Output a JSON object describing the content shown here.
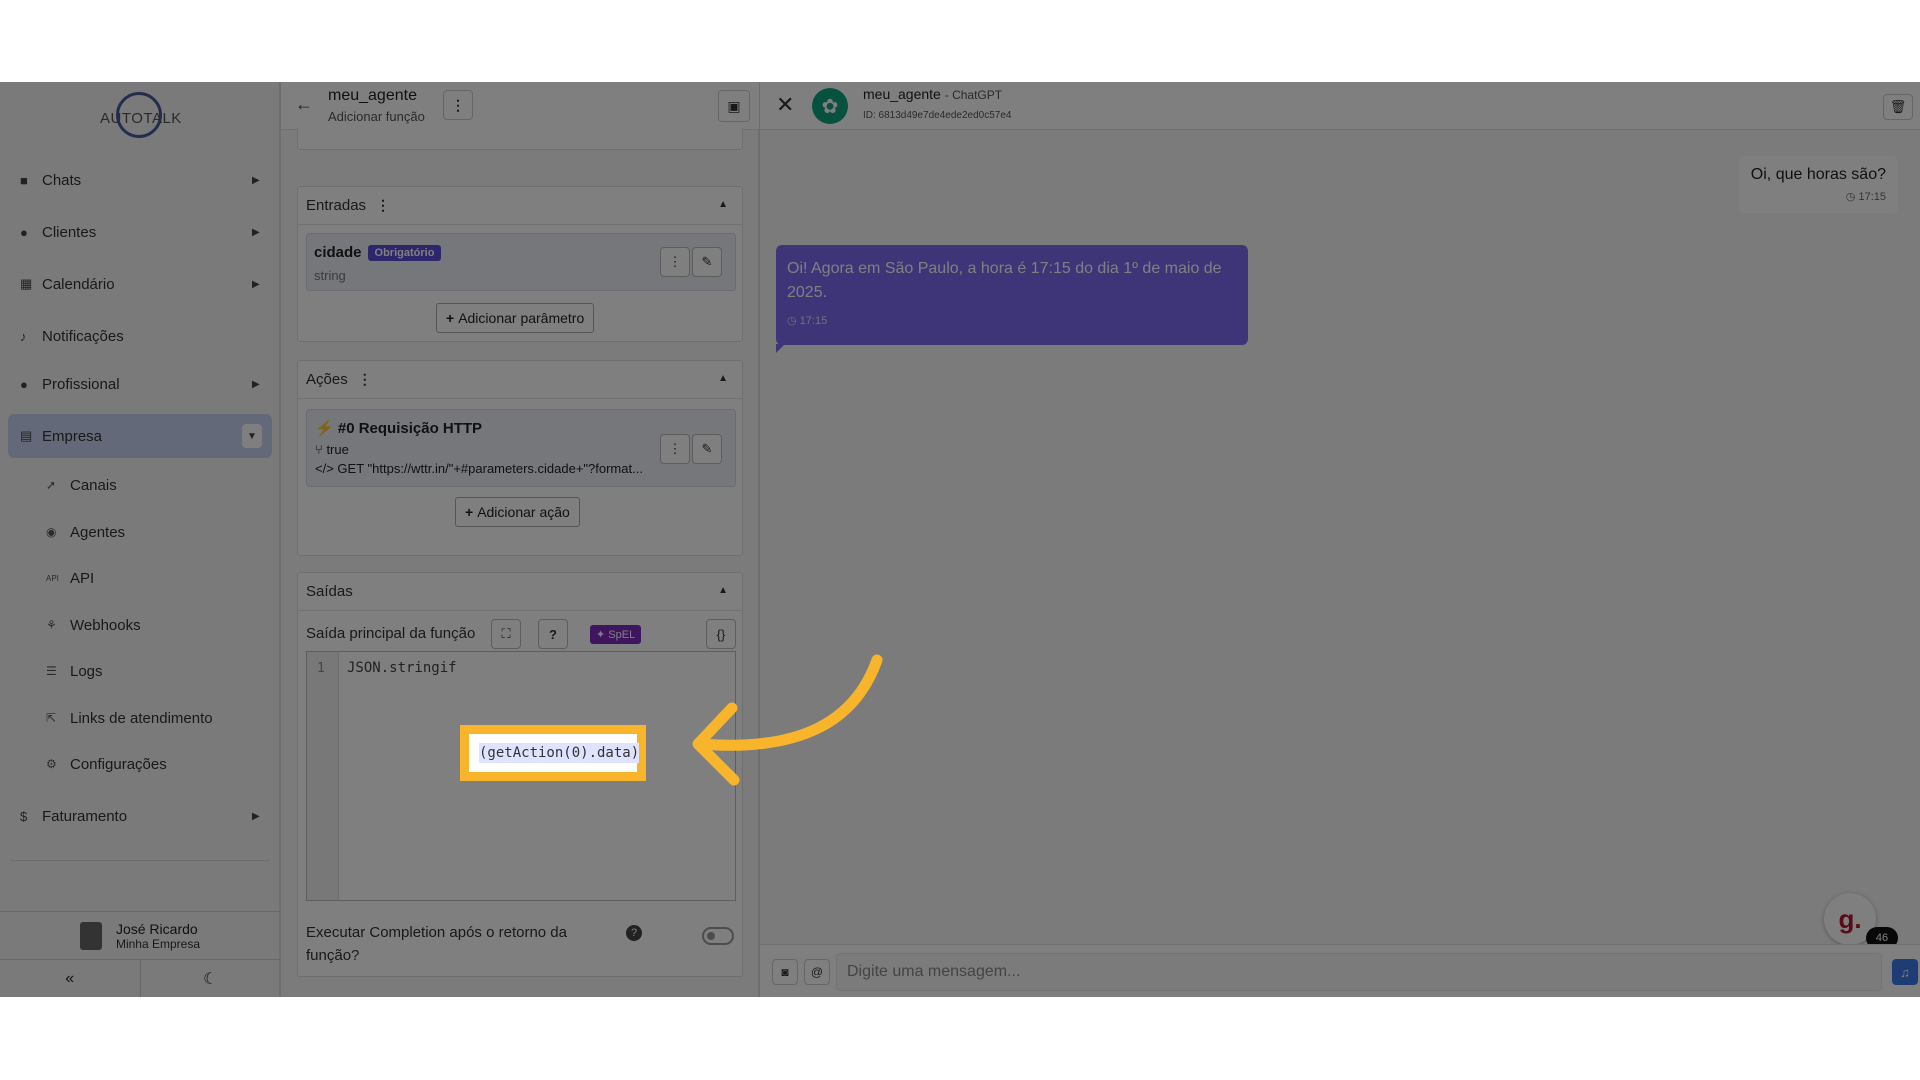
{
  "sidebar": {
    "logo": "AUTOTALK",
    "items": [
      {
        "label": "Chats",
        "icon": "chat-icon",
        "has_arrow": true
      },
      {
        "label": "Clientes",
        "icon": "users-icon",
        "has_arrow": true
      },
      {
        "label": "Calendário",
        "icon": "calendar-icon",
        "has_arrow": true
      },
      {
        "label": "Notificações",
        "icon": "bell-icon",
        "has_arrow": false
      },
      {
        "label": "Profissional",
        "icon": "user-tie-icon",
        "has_arrow": true
      },
      {
        "label": "Empresa",
        "icon": "building-icon",
        "has_arrow": true,
        "active": true
      }
    ],
    "sub_items": [
      {
        "label": "Canais",
        "icon": "rocket-icon"
      },
      {
        "label": "Agentes",
        "icon": "robot-icon"
      },
      {
        "label": "API",
        "icon": "api-icon"
      },
      {
        "label": "Webhooks",
        "icon": "webhook-icon"
      },
      {
        "label": "Logs",
        "icon": "list-icon"
      },
      {
        "label": "Links de atendimento",
        "icon": "external-link-icon"
      },
      {
        "label": "Configurações",
        "icon": "gear-icon"
      }
    ],
    "billing": {
      "label": "Faturamento",
      "icon": "dollar-icon"
    },
    "user": {
      "name": "José Ricardo",
      "company": "Minha Empresa"
    },
    "collapse_icon": "«",
    "theme_icon": "☾"
  },
  "editor": {
    "title": "meu_agente",
    "subtitle": "Adicionar função",
    "inputs": {
      "header": "Entradas",
      "param_name": "cidade",
      "param_badge": "Obrigatório",
      "param_type": "string",
      "add_label": "Adicionar parâmetro"
    },
    "actions": {
      "header": "Ações",
      "action_title": "#0 Requisição HTTP",
      "action_condition": "true",
      "action_request": "GET \"https://wttr.in/\"+#parameters.cidade+\"?format...",
      "add_label": "Adicionar ação"
    },
    "outputs": {
      "header": "Saídas",
      "main_output_label": "Saída principal da função",
      "spel_badge": "SpEL",
      "line_number": "1",
      "code": "JSON.stringif",
      "highlighted_code": "(getAction(0).data)",
      "completion_label": "Executar Completion após o retorno da função?",
      "completion_enabled": false
    }
  },
  "chat": {
    "agent_name": "meu_agente",
    "model": "ChatGPT",
    "agent_id": "ID: 6813d49e7de4ede2ed0c57e4",
    "messages": [
      {
        "direction": "out",
        "text": "Oi, que horas são?",
        "time": "17:15"
      },
      {
        "direction": "in",
        "text": "Oi! Agora em São Paulo, a hora é 17:15 do dia 1º de maio de 2025.",
        "time": "17:15"
      }
    ],
    "input_placeholder": "Digite uma mensagem...",
    "widget_letter": "g.",
    "widget_count": "46"
  },
  "colors": {
    "highlight": "#f8b52c",
    "bubble_in": "#7a6af0",
    "badge": "#5b4dd6",
    "spel": "#7e2bbf",
    "active_nav": "#c6d2f2"
  }
}
